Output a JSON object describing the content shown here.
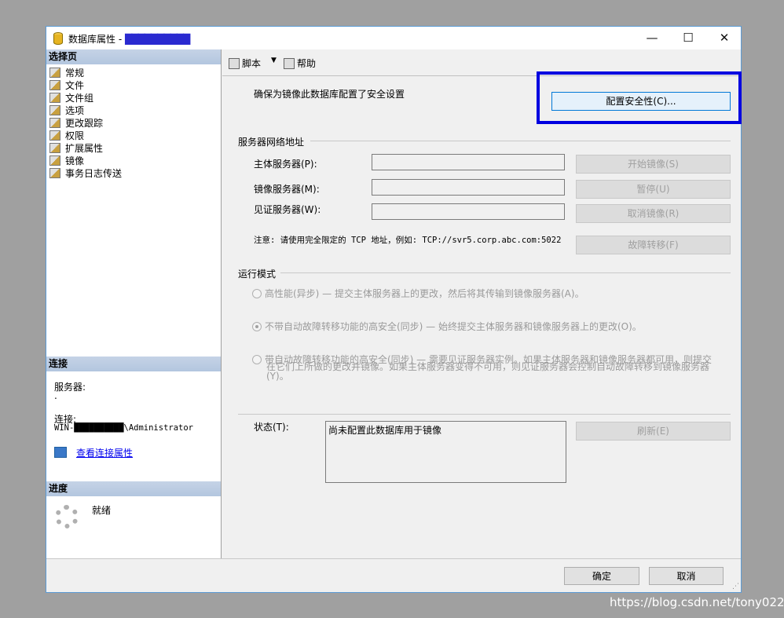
{
  "window": {
    "title": "数据库属性 - ",
    "title_obscured": "██████████",
    "minimize_glyph": "—",
    "maximize_glyph": "☐",
    "close_glyph": "✕"
  },
  "left_pane": {
    "select_page_header": "选择页",
    "nav_items": [
      {
        "label": "常规",
        "icon": "page-icon"
      },
      {
        "label": "文件",
        "icon": "page-icon"
      },
      {
        "label": "文件组",
        "icon": "page-icon"
      },
      {
        "label": "选项",
        "icon": "page-icon"
      },
      {
        "label": "更改跟踪",
        "icon": "page-icon"
      },
      {
        "label": "权限",
        "icon": "page-icon"
      },
      {
        "label": "扩展属性",
        "icon": "page-icon"
      },
      {
        "label": "镜像",
        "icon": "page-icon"
      },
      {
        "label": "事务日志传送",
        "icon": "page-icon"
      }
    ],
    "connection_header": "连接",
    "server_label": "服务器:",
    "server_value": ".",
    "connection_label": "连接:",
    "connection_value": "WIN-██████████\\Administrator",
    "view_connection_link": "查看连接属性",
    "progress_header": "进度",
    "progress_status": "就绪"
  },
  "toolbar": {
    "script_label": "脚本",
    "help_label": "帮助",
    "dropdown_glyph": "▼"
  },
  "security": {
    "prompt": "确保为镜像此数据库配置了安全设置",
    "configure_button": "配置安全性(C)..."
  },
  "network": {
    "group_title": "服务器网络地址",
    "principal_label": "主体服务器(P):",
    "principal_value": "",
    "mirror_label": "镜像服务器(M):",
    "mirror_value": "",
    "witness_label": "见证服务器(W):",
    "witness_value": "",
    "start_button": "开始镜像(S)",
    "pause_button": "暂停(U)",
    "remove_button": "取消镜像(R)",
    "failover_button": "故障转移(F)",
    "note": "注意: 请使用完全限定的 TCP 地址，例如: TCP://svr5.corp.abc.com:5022"
  },
  "operating_mode": {
    "group_title": "运行模式",
    "high_performance": "高性能(异步) — 提交主体服务器上的更改，然后将其传输到镜像服务器(A)。",
    "high_safety_no_failover": "不带自动故障转移功能的高安全(同步) — 始终提交主体服务器和镜像服务器上的更改(O)。",
    "high_safety_failover_line1": "带自动故障转移功能的高安全(同步) — 需要见证服务器实例。如果主体服务器和镜像服务器都可用，则提交",
    "high_safety_failover_line2": "在它们上所做的更改并镜像。如果主体服务器变得不可用，则见证服务器会控制自动故障转移到镜像服务器",
    "high_safety_failover_line3": "(Y)。",
    "selected": "high_safety_no_failover"
  },
  "status": {
    "label": "状态(T):",
    "value": "尚未配置此数据库用于镜像",
    "refresh_button": "刷新(E)"
  },
  "footer": {
    "ok_button": "确定",
    "cancel_button": "取消"
  },
  "watermark": "https://blog.csdn.net/tony0225",
  "colors": {
    "highlight_box": "#0000e0",
    "section_header": "#b3c6df",
    "link": "#0000ee"
  }
}
